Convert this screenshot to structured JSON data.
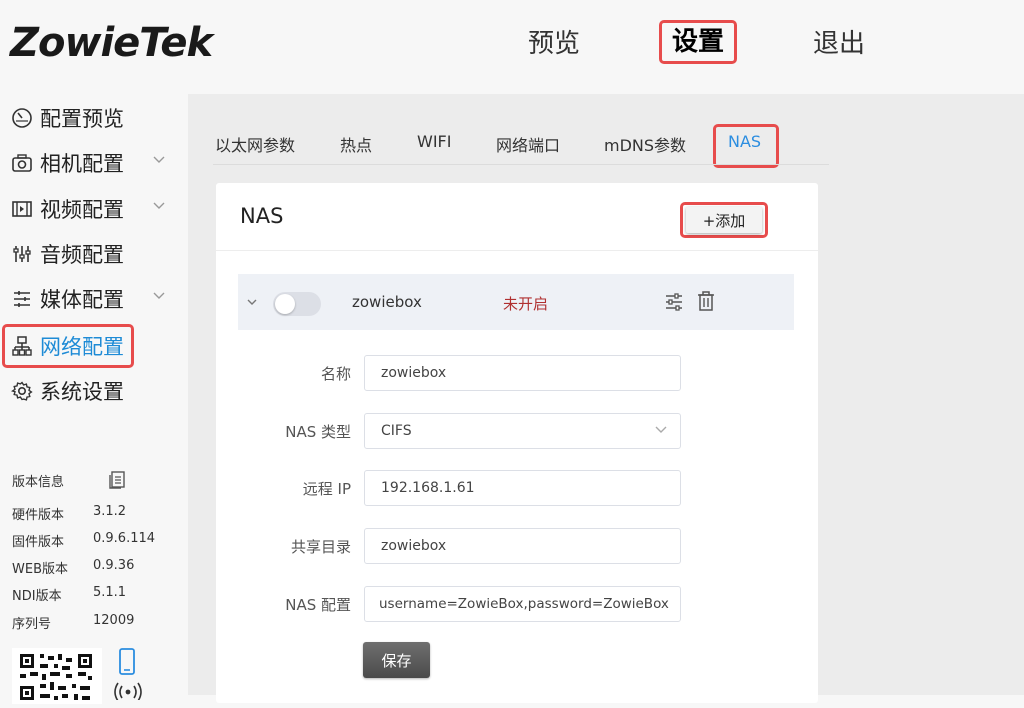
{
  "brand": {
    "logo_text": "ZowieTek"
  },
  "topnav": {
    "preview": "预览",
    "settings": "设置",
    "logout": "退出"
  },
  "sidebar": {
    "items": [
      {
        "label": "配置预览",
        "icon": "dashboard-icon"
      },
      {
        "label": "相机配置",
        "icon": "camera-icon"
      },
      {
        "label": "视频配置",
        "icon": "film-icon"
      },
      {
        "label": "音频配置",
        "icon": "audio-mixer-icon"
      },
      {
        "label": "媒体配置",
        "icon": "media-icon"
      },
      {
        "label": "网络配置",
        "icon": "network-icon"
      },
      {
        "label": "系统设置",
        "icon": "gear-icon"
      }
    ],
    "active_index": 5
  },
  "version": {
    "title": "版本信息",
    "rows": [
      {
        "label": "硬件版本",
        "value": "3.1.2"
      },
      {
        "label": "固件版本",
        "value": "0.9.6.114"
      },
      {
        "label": "WEB版本",
        "value": "0.9.36"
      },
      {
        "label": "NDI版本",
        "value": "5.1.1"
      },
      {
        "label": "序列号",
        "value": "12009"
      }
    ]
  },
  "tabs": [
    {
      "label": "以太网参数"
    },
    {
      "label": "热点"
    },
    {
      "label": "WIFI"
    },
    {
      "label": "网络端口"
    },
    {
      "label": "mDNS参数"
    },
    {
      "label": "NAS"
    }
  ],
  "card": {
    "title": "NAS",
    "add_label": "+添加"
  },
  "nas_entry": {
    "name": "zowiebox",
    "status": "未开启",
    "enabled": false
  },
  "form": {
    "name_label": "名称",
    "name_value": "zowiebox",
    "type_label": "NAS 类型",
    "type_value": "CIFS",
    "ip_label": "远程 IP",
    "ip_value": "192.168.1.61",
    "share_label": "共享目录",
    "share_value": "zowiebox",
    "config_label": "NAS 配置",
    "config_value": "username=ZowieBox,password=ZowieBox",
    "save_label": "保存"
  },
  "colors": {
    "accent": "#2b8de0",
    "highlight": "#e74c4c",
    "status_off": "#b03030"
  }
}
